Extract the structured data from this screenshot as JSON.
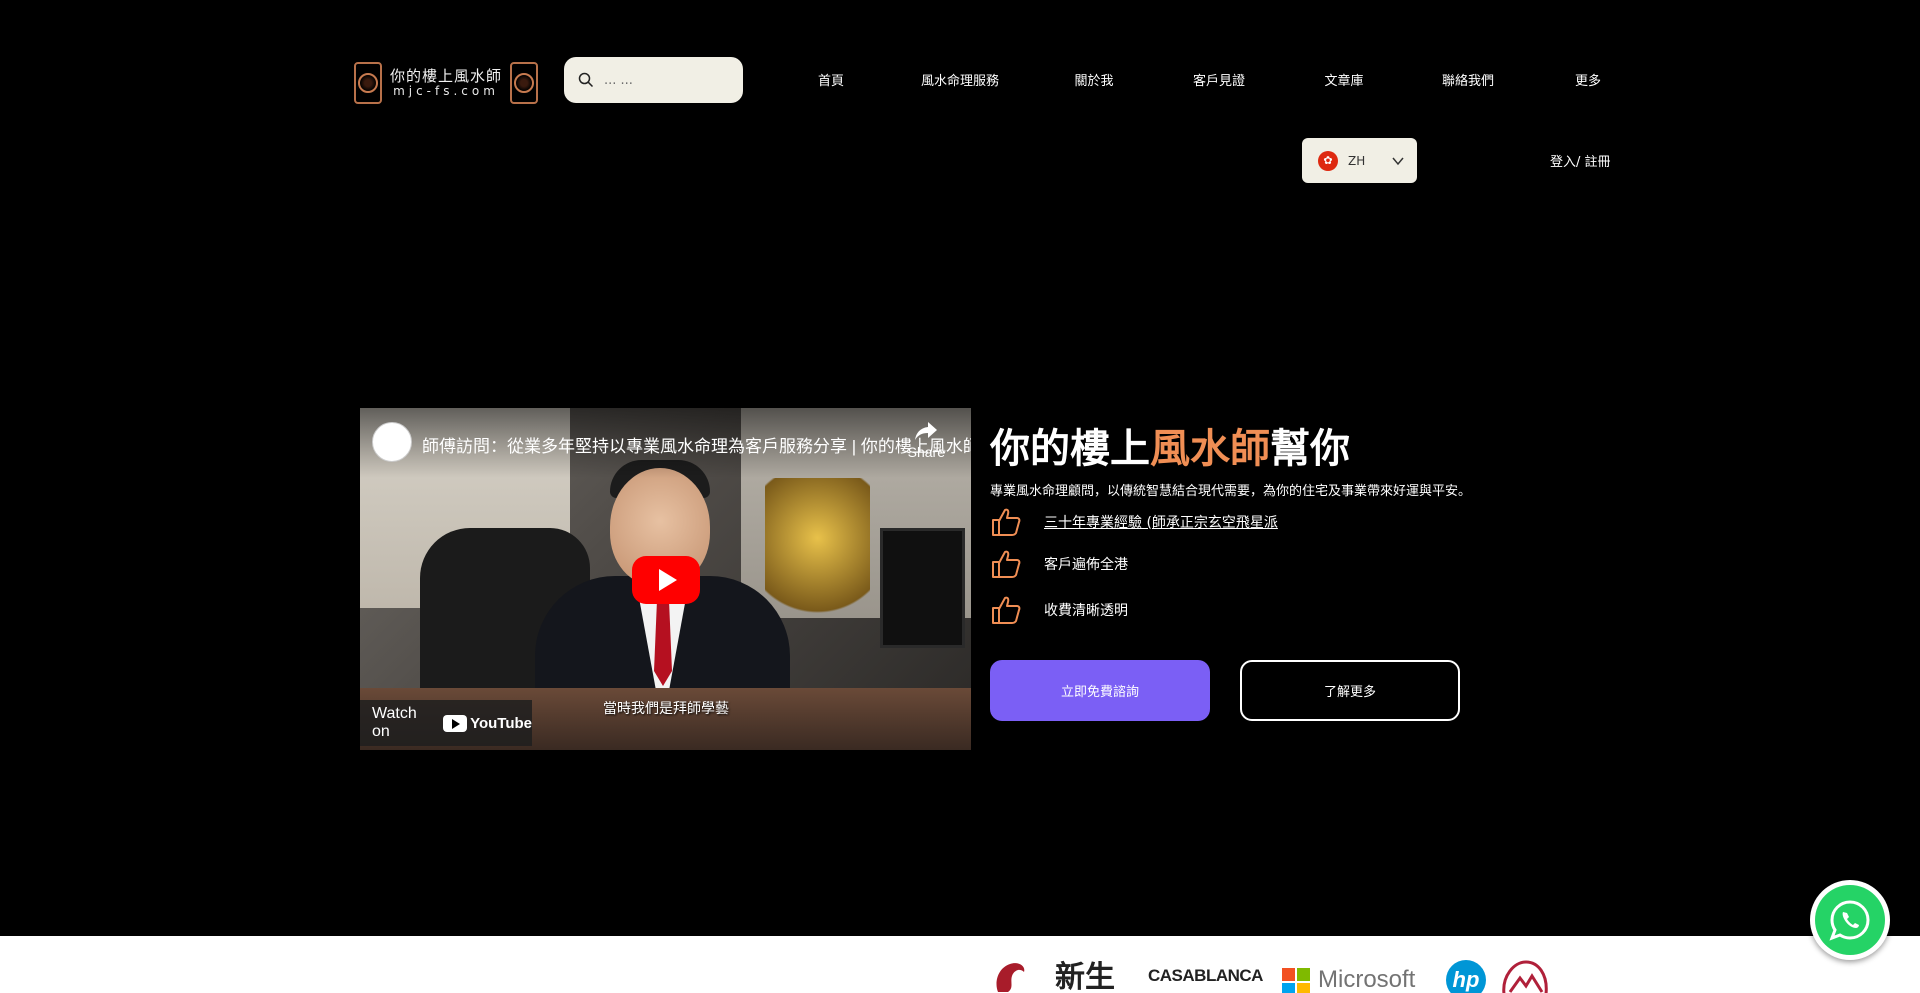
{
  "header": {
    "logo": {
      "cn_text": "你的樓上風水師",
      "en_text": "mjc-fs.com"
    },
    "search": {
      "placeholder": "... ..."
    },
    "nav": [
      {
        "label": "首頁"
      },
      {
        "label": "風水命理服務"
      },
      {
        "label": "關於我"
      },
      {
        "label": "客戶見證"
      },
      {
        "label": "文章庫"
      },
      {
        "label": "聯絡我們"
      },
      {
        "label": "更多"
      }
    ],
    "language": {
      "code": "ZH",
      "flag_icon": "hong-kong-flag-icon"
    },
    "login_label": "登入/ 註冊"
  },
  "hero": {
    "video": {
      "title": "師傅訪問：從業多年堅持以專業風水命理為客戶服務分享 | 你的樓上風水師 mjc-fs.com",
      "share_label": "Share",
      "watch_label": "Watch on",
      "youtube_label": "YouTube",
      "subtitle": "當時我們是拜師學藝"
    },
    "headline": {
      "before": "你的樓上",
      "accent": "風水師",
      "after": "幫你"
    },
    "subline": "專業風水命理顧問，以傳統智慧結合現代需要，為你的住宅及事業帶來好運與平安。",
    "features": [
      {
        "text": "三十年專業經驗 (師承正宗玄空飛星派",
        "icon": "thumbs-up-icon"
      },
      {
        "text": "客戶遍佈全港",
        "icon": "thumbs-up-icon"
      },
      {
        "text": "收費清晰透明",
        "icon": "thumbs-up-icon"
      }
    ],
    "primary_button": "立即免費諮詢",
    "secondary_button": "了解更多"
  },
  "brands": [
    {
      "name": "新生"
    },
    {
      "name": "CASABLANCA"
    },
    {
      "name": "Microsoft"
    },
    {
      "name": "hp"
    }
  ],
  "colors": {
    "accent": "#f08e54",
    "primary_button": "#7b5ff5",
    "whatsapp": "#25d366"
  }
}
